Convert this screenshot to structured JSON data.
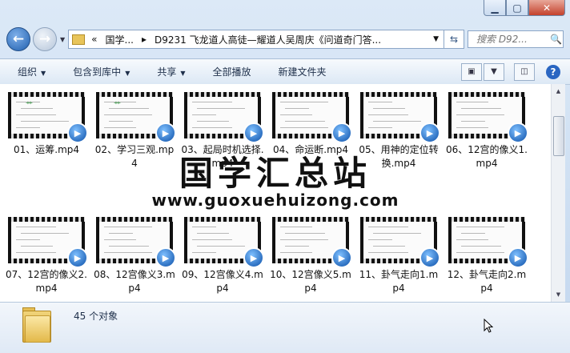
{
  "window": {
    "min_label": "▁",
    "max_label": "▢",
    "close_label": "✕"
  },
  "address": {
    "prefix": "«",
    "segment1": "国学...",
    "separator": "▸",
    "segment2": "D9231 飞龙道人高徒—耀道人吴周庆《问道奇门答...",
    "dropdown": "▼",
    "refresh": "⇆"
  },
  "search": {
    "placeholder": "搜索 D92...",
    "icon": "🔍"
  },
  "toolbar": {
    "organize": "组织",
    "include_library": "包含到库中",
    "share": "共享",
    "play_all": "全部播放",
    "new_folder": "新建文件夹",
    "arrow": "▼"
  },
  "files": [
    {
      "name": "01、运筹.mp4"
    },
    {
      "name": "02、学习三观.mp4"
    },
    {
      "name": "03、起局时机选择.mp4"
    },
    {
      "name": "04、命运断.mp4"
    },
    {
      "name": "05、用神的定位转换.mp4"
    },
    {
      "name": "06、12宫的像义1.mp4"
    },
    {
      "name": "07、12宫的像义2.mp4"
    },
    {
      "name": "08、12宫像义3.mp4"
    },
    {
      "name": "09、12宫像义4.mp4"
    },
    {
      "name": "10、12宫像义5.mp4"
    },
    {
      "name": "11、卦气走向1.mp4"
    },
    {
      "name": "12、卦气走向2.mp4"
    }
  ],
  "watermark": {
    "title": "国学汇总站",
    "url": "www.guoxuehuizong.com"
  },
  "status": {
    "count_text": "45 个对象"
  },
  "help_label": "?"
}
